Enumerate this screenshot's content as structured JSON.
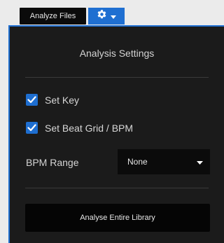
{
  "toolbar": {
    "analyze_label": "Analyze Files",
    "settings_icon": "gear-icon",
    "dropdown_icon": "caret-down-icon"
  },
  "settings": {
    "title": "Analysis Settings",
    "set_key_label": "Set Key",
    "set_beat_grid_label": "Set Beat Grid / BPM",
    "set_key_checked": true,
    "set_beat_grid_checked": true,
    "bpm_range_label": "BPM Range",
    "bpm_range_value": "None",
    "analyse_button_label": "Analyse Entire Library"
  },
  "colors": {
    "accent": "#1f6fd1",
    "panel_bg": "#1b1b1b",
    "button_bg": "#050505",
    "page_bg": "#ebebeb"
  }
}
